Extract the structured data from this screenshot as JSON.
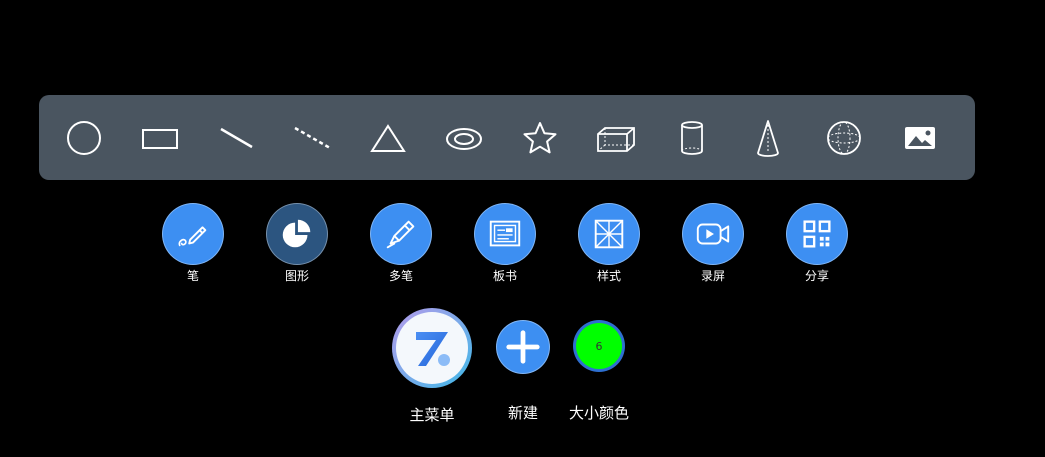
{
  "shapes": [
    {
      "name": "circle-shape-icon"
    },
    {
      "name": "rectangle-shape-icon"
    },
    {
      "name": "line-shape-icon"
    },
    {
      "name": "dashed-line-shape-icon"
    },
    {
      "name": "triangle-shape-icon"
    },
    {
      "name": "ellipse-ring-shape-icon"
    },
    {
      "name": "star-shape-icon"
    },
    {
      "name": "cuboid-shape-icon"
    },
    {
      "name": "cylinder-shape-icon"
    },
    {
      "name": "cone-shape-icon"
    },
    {
      "name": "sphere-shape-icon"
    },
    {
      "name": "image-icon"
    }
  ],
  "tools": [
    {
      "label": "笔",
      "icon": "pen-icon"
    },
    {
      "label": "图形",
      "icon": "pie-chart-icon",
      "active": true
    },
    {
      "label": "多笔",
      "icon": "multi-pen-icon"
    },
    {
      "label": "板书",
      "icon": "blackboard-icon"
    },
    {
      "label": "样式",
      "icon": "style-grid-icon"
    },
    {
      "label": "录屏",
      "icon": "video-record-icon"
    },
    {
      "label": "分享",
      "icon": "qr-code-icon"
    }
  ],
  "bottom": {
    "main_menu_label": "主菜单",
    "new_label": "新建",
    "size_color_label": "大小颜色",
    "size_value": "6",
    "current_color": "#00ff00"
  },
  "colors": {
    "toolbar_bg": "#4a5560",
    "tool_blue": "#3d8ff2",
    "tool_active": "#2c5580"
  }
}
